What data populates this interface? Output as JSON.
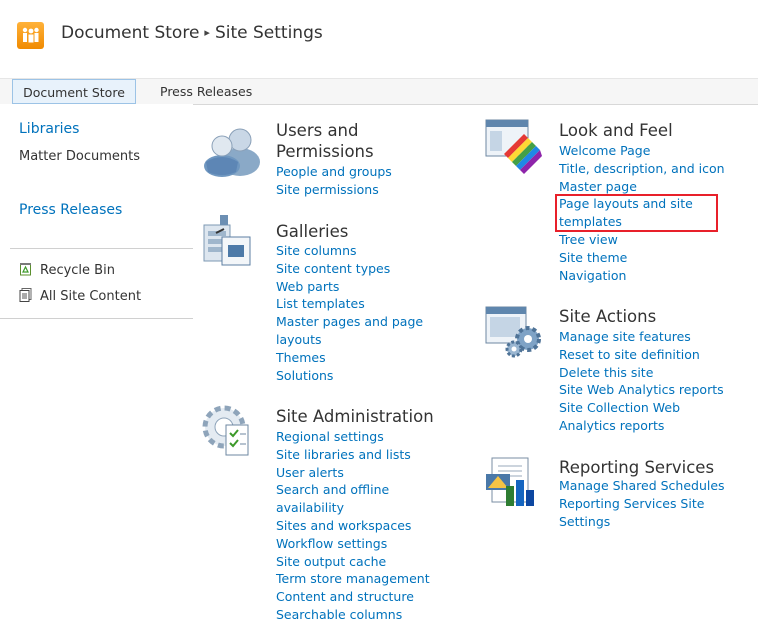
{
  "header": {
    "site_name": "Document Store",
    "page_title": "Site Settings",
    "separator": "▸"
  },
  "topnav": {
    "tabs": [
      {
        "label": "Document Store",
        "active": true
      },
      {
        "label": "Press Releases",
        "active": false
      }
    ]
  },
  "quicklaunch": {
    "libraries_heading": "Libraries",
    "matter_documents": "Matter Documents",
    "press_releases_heading": "Press Releases",
    "recycle_bin": "Recycle Bin",
    "all_site_content": "All Site Content"
  },
  "sections": {
    "users": {
      "title_line1": "Users and",
      "title_line2": "Permissions",
      "links": [
        "People and groups",
        "Site permissions"
      ]
    },
    "galleries": {
      "title": "Galleries",
      "links": [
        "Site columns",
        "Site content types",
        "Web parts",
        "List templates",
        "Master pages and page",
        "layouts",
        "Themes",
        "Solutions"
      ]
    },
    "site_admin": {
      "title": "Site Administration",
      "links": [
        "Regional settings",
        "Site libraries and lists",
        "User alerts",
        "Search and offline",
        "availability",
        "Sites and workspaces",
        "Workflow settings",
        "Site output cache",
        "Term store management",
        "Content and structure",
        "Searchable columns"
      ]
    },
    "look_feel": {
      "title": "Look and Feel",
      "links": [
        "Welcome Page",
        "Title, description, and icon",
        "Master page",
        "Page layouts and site",
        "templates",
        "Tree view",
        "Site theme",
        "Navigation"
      ]
    },
    "site_actions": {
      "title": "Site Actions",
      "links": [
        "Manage site features",
        "Reset to site definition",
        "Delete this site",
        "Site Web Analytics reports",
        "Site Collection Web",
        "Analytics reports"
      ]
    },
    "reporting": {
      "title": "Reporting Services",
      "links": [
        "Manage Shared Schedules",
        "Reporting Services Site",
        "Settings"
      ]
    }
  },
  "colors": {
    "link": "#0072bc",
    "highlight_border": "#e8202a",
    "site_icon": "#f39c12"
  },
  "icons": [
    "site-logo-icon",
    "users-icon",
    "galleries-icon",
    "site-admin-icon",
    "look-feel-icon",
    "site-actions-icon",
    "reporting-icon",
    "recycle-bin-icon",
    "all-site-content-icon"
  ]
}
